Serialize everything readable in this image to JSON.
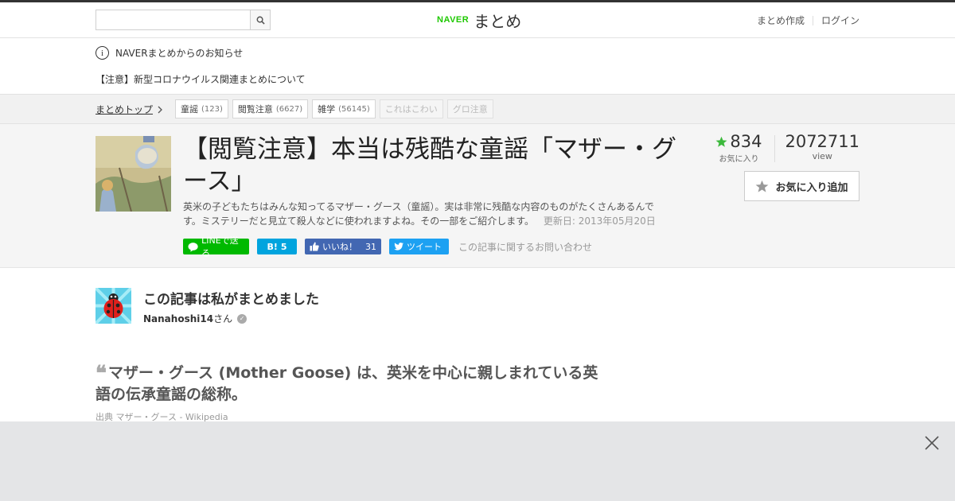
{
  "header": {
    "search_placeholder": "",
    "logo_naver": "NAVER",
    "logo_matome": "まとめ",
    "links": [
      "まとめ作成",
      "ログイン"
    ]
  },
  "notice": {
    "heading": "NAVERまとめからのお知らせ",
    "item": "【注意】新型コロナウイルス関連まとめについて"
  },
  "breadcrumb": {
    "top": "まとめトップ"
  },
  "tags": [
    {
      "label": "童謡",
      "count": "(123)"
    },
    {
      "label": "閲覧注意",
      "count": "(6627)"
    },
    {
      "label": "雑学",
      "count": "(56145)"
    },
    {
      "label": "これはこわい",
      "count": ""
    },
    {
      "label": "グロ注意",
      "count": ""
    }
  ],
  "article": {
    "title": "【閲覧注意】本当は残酷な童謡「マザー・グース」",
    "description": "英米の子どもたちはみんな知ってるマザー・グース（童謡）。実は非常に残酷な内容のものがたくさんあるんです。ミステリーだと見立て殺人などに使われますよね。その一部をご紹介します。",
    "updated": "更新日: 2013年05月20日",
    "favorites": "834",
    "favorites_label": "お気に入り",
    "views": "2072711",
    "views_label": "view",
    "fav_button": "お気に入り追加",
    "contact": "この記事に関するお問い合わせ"
  },
  "social": {
    "line": "LINEで送る",
    "hatena_icon": "B!",
    "hatena_count": "5",
    "fb_label": "いいね！",
    "fb_count": "31",
    "tweet": "ツイート"
  },
  "curator": {
    "heading": "この記事は私がまとめました",
    "name": "Nanahoshi14",
    "suffix": "さん"
  },
  "quote": {
    "text": "マザー・グース (Mother Goose) は、英米を中心に親しまれている英語の伝承童謡の総称。",
    "source_prefix": "出典",
    "source": "マザー・グース - Wikipedia"
  },
  "colors": {
    "naver_green": "#1ec800",
    "star_green": "#3cb93c",
    "line_green": "#00b900",
    "hatena_blue": "#00a4de",
    "facebook_blue": "#4267b2",
    "twitter_blue": "#1da1f2"
  }
}
